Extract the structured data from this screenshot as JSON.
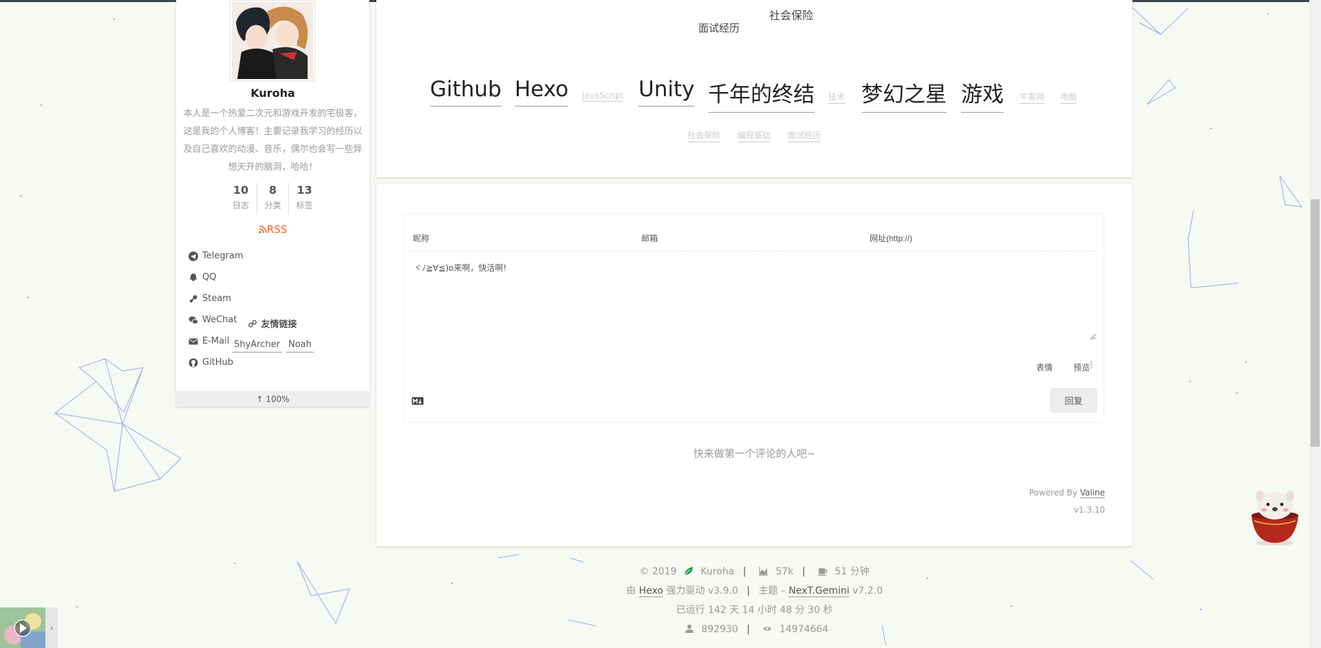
{
  "sidebar": {
    "author": "Kuroha",
    "description": "本人是一个热爱二次元和游戏开发的宅极客，这是我的个人博客！主要记录我学习的经历以及自己喜欢的动漫、音乐，偶尔也会写一些异想天开的脑洞，哈哈！",
    "stats": [
      {
        "count": "10",
        "label": "日志"
      },
      {
        "count": "8",
        "label": "分类"
      },
      {
        "count": "13",
        "label": "标签"
      }
    ],
    "rss": "RSS",
    "social": [
      {
        "label": "Telegram",
        "icon": "telegram-icon"
      },
      {
        "label": "QQ",
        "icon": "qq-icon"
      },
      {
        "label": "Steam",
        "icon": "steam-icon"
      },
      {
        "label": "WeChat",
        "icon": "wechat-icon"
      },
      {
        "label": "E-Mail",
        "icon": "envelope-icon"
      },
      {
        "label": "GitHub",
        "icon": "github-icon"
      }
    ],
    "links_title": "友情链接",
    "links": [
      "ShyArcher",
      "Noah"
    ],
    "progress": "100%"
  },
  "tag_cloud": {
    "overlay_tags": [
      "社会保险",
      "面试经历"
    ],
    "tags": [
      {
        "label": "Github",
        "size": "big"
      },
      {
        "label": "Hexo",
        "size": "big"
      },
      {
        "label": "JavaScript",
        "size": "small"
      },
      {
        "label": "Unity",
        "size": "big"
      },
      {
        "label": "千年的终结",
        "size": "big"
      },
      {
        "label": "技术",
        "size": "small"
      },
      {
        "label": "梦幻之星",
        "size": "big"
      },
      {
        "label": "游戏",
        "size": "big"
      },
      {
        "label": "牛客网",
        "size": "small"
      },
      {
        "label": "电脑",
        "size": "small"
      },
      {
        "label": "社会保险",
        "size": "small"
      },
      {
        "label": "编程基础",
        "size": "small"
      },
      {
        "label": "面试经历",
        "size": "small"
      }
    ]
  },
  "comments": {
    "nick_placeholder": "昵称",
    "mail_placeholder": "邮箱",
    "link_placeholder": "网址(http://)",
    "text_placeholder": "ヾﾉ≧∀≦)o来啊，快活啊!",
    "emoji": "表情",
    "preview": "预览",
    "submit": "回复",
    "empty": "快来做第一个评论的人吧~",
    "powered_by": "Powered By",
    "powered_link": "Valine",
    "version": "v1.3.10"
  },
  "footer": {
    "copyright": "© 2019",
    "author": "Kuroha",
    "word_count": "57k",
    "read_time": "51 分钟",
    "powered_prefix": "由",
    "hexo": "Hexo",
    "powered_suffix": "强力驱动 v3.9.0",
    "theme_prefix": "主题 –",
    "theme": "NexT.Gemini",
    "theme_version": "v7.2.0",
    "uptime": "已运行 142 天 14 小时 48 分 30 秒",
    "visitors": "892930",
    "views": "14974664"
  },
  "colors": {
    "rss": "#fc6423",
    "leaf": "#0a9b3c",
    "lines": "#4b5ee8"
  }
}
